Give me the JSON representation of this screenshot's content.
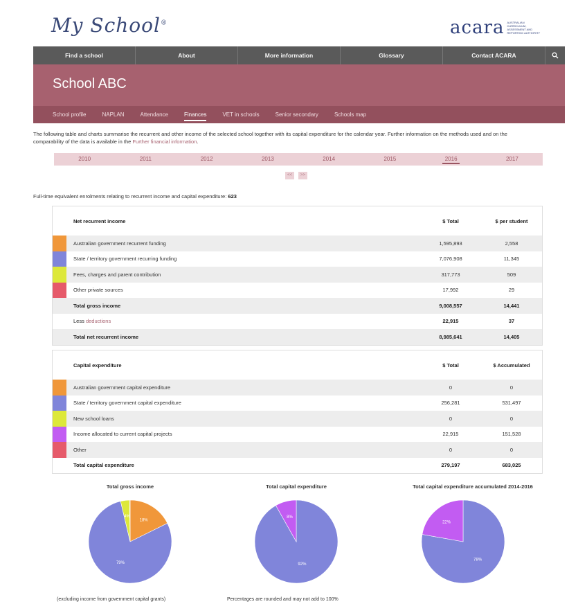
{
  "logo": {
    "text": "My School",
    "mark": "®"
  },
  "acara": {
    "word": "acara",
    "sub": "AUSTRALIAN CURRICULUM, ASSESSMENT AND REPORTING AUTHORITY"
  },
  "nav": {
    "items": [
      "Find a school",
      "About",
      "More information",
      "Glossary",
      "Contact ACARA"
    ],
    "search_icon": "search-icon"
  },
  "school_name": "School ABC",
  "tabs": [
    "School profile",
    "NAPLAN",
    "Attendance",
    "Finances",
    "VET in schools",
    "Senior secondary",
    "Schools map"
  ],
  "intro": {
    "text": "The following table and charts summarise the recurrent and other income of the selected school together with its capital expenditure for the calendar year. Further information on the methods used and on the comparability of the data is available in the",
    "link": "Further financial information",
    "end": "."
  },
  "years": [
    "2010",
    "2011",
    "2012",
    "2013",
    "2014",
    "2015",
    "2016",
    "2017"
  ],
  "pager": {
    "prev": "<<",
    "next": ">>"
  },
  "fte": {
    "label": "Full-time equivalent enrolments relating to recurrent income and capital expenditure:",
    "value": "623"
  },
  "income_table": {
    "headers": [
      "Net recurrent income",
      "$ Total",
      "$ per student"
    ],
    "rows": [
      {
        "label": "Australian government recurrent funding",
        "total": "1,595,893",
        "per": "2,558",
        "color": "#f0973a"
      },
      {
        "label": "State / territory government recurring funding",
        "total": "7,076,908",
        "per": "11,345",
        "color": "#8085da"
      },
      {
        "label": "Fees, charges and parent contribution",
        "total": "317,773",
        "per": "509",
        "color": "#dde83a"
      },
      {
        "label": "Other private sources",
        "total": "17,992",
        "per": "29",
        "color": "#e65a6a"
      }
    ],
    "gross": {
      "label": "Total gross income",
      "total": "9,008,557",
      "per": "14,441"
    },
    "less": {
      "label": "Less",
      "link": "deductions",
      "total": "22,915",
      "per": "37"
    },
    "net": {
      "label": "Total net recurrent income",
      "total": "8,985,641",
      "per": "14,405"
    }
  },
  "capital_table": {
    "headers": [
      "Capital expenditure",
      "$ Total",
      "$ Accumulated"
    ],
    "rows": [
      {
        "label": "Australian government capital expenditure",
        "total": "0",
        "acc": "0",
        "color": "#f0973a"
      },
      {
        "label": "State / territory government capital expenditure",
        "total": "256,281",
        "acc": "531,497",
        "color": "#8085da"
      },
      {
        "label": "New school loans",
        "total": "0",
        "acc": "0",
        "color": "#dde83a"
      },
      {
        "label": "Income allocated to current capital projects",
        "total": "22,915",
        "acc": "151,528",
        "color": "#c25cf2"
      },
      {
        "label": "Other",
        "total": "0",
        "acc": "0",
        "color": "#e65a6a"
      }
    ],
    "total": {
      "label": "Total capital expenditure",
      "total": "279,197",
      "acc": "683,025"
    }
  },
  "chart_data": [
    {
      "type": "pie",
      "title": "Total gross income",
      "note": "(excluding income from government capital grants)",
      "slices": [
        {
          "label": "18%",
          "value": 17.7,
          "color": "#f0973a"
        },
        {
          "label": "79%",
          "value": 78.6,
          "color": "#8085da"
        },
        {
          "label": "4%",
          "value": 3.5,
          "color": "#dde83a"
        },
        {
          "label": "",
          "value": 0.2,
          "color": "#e65a6a"
        }
      ]
    },
    {
      "type": "pie",
      "title": "Total capital expenditure",
      "note": "Percentages are rounded and may not add to 100%",
      "slices": [
        {
          "label": "92%",
          "value": 91.8,
          "color": "#8085da"
        },
        {
          "label": "8%",
          "value": 8.2,
          "color": "#c25cf2"
        }
      ]
    },
    {
      "type": "pie",
      "title": "Total capital expenditure accumulated 2014-2016",
      "note": "",
      "slices": [
        {
          "label": "78%",
          "value": 77.8,
          "color": "#8085da"
        },
        {
          "label": "22%",
          "value": 22.2,
          "color": "#c25cf2"
        }
      ]
    }
  ]
}
